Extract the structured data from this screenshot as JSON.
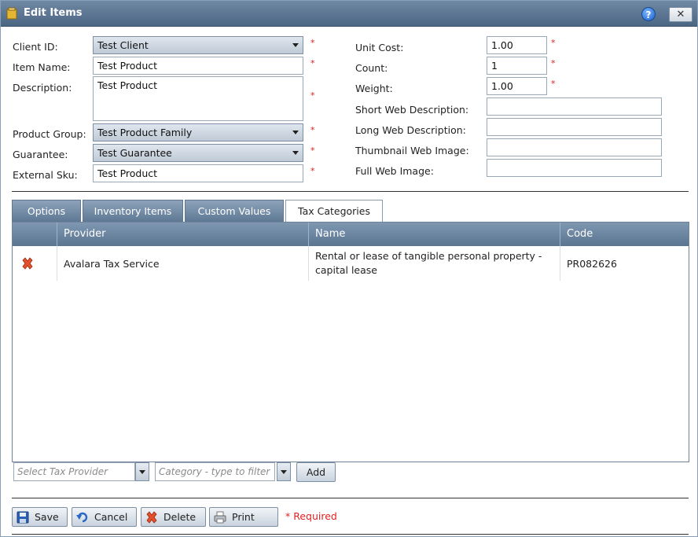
{
  "window": {
    "title": "Edit Items",
    "help": "?",
    "close": "✕"
  },
  "form": {
    "client_id": {
      "label": "Client ID:",
      "value": "Test Client"
    },
    "item_name": {
      "label": "Item Name:",
      "value": "Test Product"
    },
    "description": {
      "label": "Description:",
      "value": "Test Product"
    },
    "product_group": {
      "label": "Product Group:",
      "value": "Test Product Family"
    },
    "guarantee": {
      "label": "Guarantee:",
      "value": "Test Guarantee"
    },
    "external_sku": {
      "label": "External Sku:",
      "value": "Test Product"
    },
    "unit_cost": {
      "label": "Unit Cost:",
      "value": "1.00"
    },
    "count": {
      "label": "Count:",
      "value": "1"
    },
    "weight": {
      "label": "Weight:",
      "value": "1.00"
    },
    "short_web_description": {
      "label": "Short Web Description:",
      "value": ""
    },
    "long_web_description": {
      "label": "Long Web Description:",
      "value": ""
    },
    "thumbnail_web_image": {
      "label": "Thumbnail Web Image:",
      "value": ""
    },
    "full_web_image": {
      "label": "Full Web Image:",
      "value": ""
    },
    "required_marker": "*"
  },
  "tabs": [
    "Options",
    "Inventory Items",
    "Custom Values",
    "Tax Categories"
  ],
  "grid": {
    "columns": [
      "Provider",
      "Name",
      "Code"
    ],
    "rows": [
      {
        "provider": "Avalara Tax Service",
        "name": "Rental or lease of tangible personal property - capital lease",
        "code": "PR082626"
      }
    ]
  },
  "add_row": {
    "provider_placeholder": "Select Tax Provider",
    "category_placeholder": "Category - type to filter",
    "add_label": "Add"
  },
  "footer": {
    "save": "Save",
    "cancel": "Cancel",
    "delete": "Delete",
    "print": "Print",
    "required_note": "* Required"
  },
  "colors": {
    "titlebar": "#5a7591",
    "required": "#e02020",
    "grid_header": "#6b86a2"
  }
}
